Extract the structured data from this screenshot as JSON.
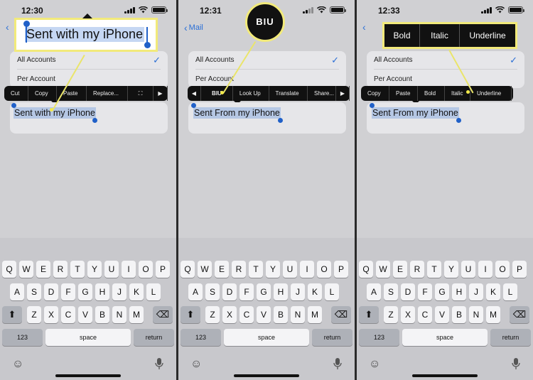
{
  "colors": {
    "accent": "#2b6fd6",
    "callout_border": "#f2ea7a",
    "menu_bg": "#111111"
  },
  "panels": [
    {
      "time": "12:30",
      "nav_back": "",
      "rows": [
        "All Accounts",
        "Per Account"
      ],
      "signature": "Sent with my iPhone",
      "menu": [
        "Cut",
        "Copy",
        "Paste",
        "Replace..."
      ],
      "menu_icons": [
        "scan-text-icon",
        "arrow-right-icon"
      ],
      "callout_text": "Sent with my iPhone"
    },
    {
      "time": "12:31",
      "nav_back": "Mail",
      "rows": [
        "All Accounts",
        "Per Account"
      ],
      "signature": "Sent From my iPhone",
      "menu": [
        "BIU",
        "Look Up",
        "Translate",
        "Share..."
      ],
      "menu_icons": [
        "arrow-left-icon",
        "arrow-right-icon"
      ],
      "callout_text": "BIU"
    },
    {
      "time": "12:33",
      "nav_back": "",
      "rows": [
        "All Accounts",
        "Per Account"
      ],
      "signature": "Sent From my iPhone",
      "menu": [
        "Copy",
        "Paste",
        "Bold",
        "Italic",
        "Underline"
      ],
      "callout_items": [
        "Bold",
        "Italic",
        "Underline"
      ]
    }
  ],
  "keyboard": {
    "row1": [
      "Q",
      "W",
      "E",
      "R",
      "T",
      "Y",
      "U",
      "I",
      "O",
      "P"
    ],
    "row2": [
      "A",
      "S",
      "D",
      "F",
      "G",
      "H",
      "J",
      "K",
      "L"
    ],
    "row3": [
      "Z",
      "X",
      "C",
      "V",
      "B",
      "N",
      "M"
    ],
    "numbers": "123",
    "space": "space",
    "return": "return",
    "icons": [
      "shift-icon",
      "delete-icon",
      "emoji-icon",
      "microphone-icon"
    ]
  }
}
